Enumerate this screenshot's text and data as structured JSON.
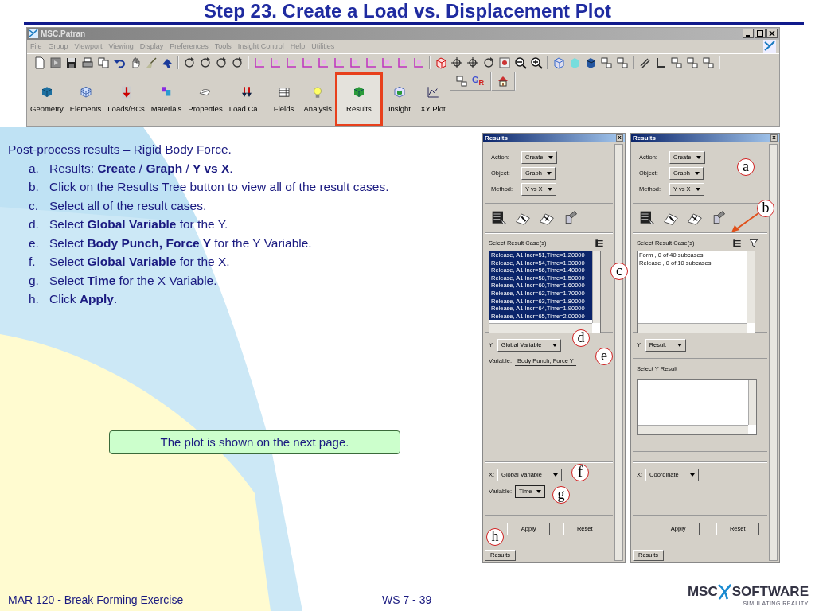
{
  "title": "Step 23. Create a Load vs. Displacement Plot",
  "app_window": {
    "title": "MSC.Patran",
    "menu": [
      "File",
      "Group",
      "Viewport",
      "Viewing",
      "Display",
      "Preferences",
      "Tools",
      "Insight Control",
      "Help",
      "Utilities"
    ],
    "apps": [
      {
        "label": "Geometry",
        "selected": false
      },
      {
        "label": "Elements",
        "selected": false
      },
      {
        "label": "Loads/BCs",
        "selected": false
      },
      {
        "label": "Materials",
        "selected": false
      },
      {
        "label": "Properties",
        "selected": false
      },
      {
        "label": "Load Ca...",
        "selected": false
      },
      {
        "label": "Fields",
        "selected": false
      },
      {
        "label": "Analysis",
        "selected": false
      },
      {
        "label": "Results",
        "selected": true
      },
      {
        "label": "Insight",
        "selected": false
      },
      {
        "label": "XY Plot",
        "selected": false
      }
    ],
    "gr_button": "G$_{R}$"
  },
  "instructions": {
    "intro": "Post-process results – Rigid Body Force.",
    "steps": [
      {
        "marker": "a.",
        "text": "Results: **Create** / **Graph** /   **Y vs X**."
      },
      {
        "marker": "b.",
        "text": "Click on the Results Tree button to view all of the result cases."
      },
      {
        "marker": "c.",
        "text": "Select all of the result cases."
      },
      {
        "marker": "d.",
        "text": "Select **Global Variable** for the Y."
      },
      {
        "marker": "e.",
        "text": "Select **Body Punch, Force Y** for the Y Variable."
      },
      {
        "marker": "f.",
        "text": "Select **Global Variable** for the X."
      },
      {
        "marker": "g.",
        "text": "Select **Time** for the X Variable."
      },
      {
        "marker": "h.",
        "text": "Click **Apply**."
      }
    ]
  },
  "note": "The plot is shown on the next page.",
  "panels": [
    {
      "title": "Results",
      "close": "x",
      "action": {
        "label": "Action:",
        "value": "Create"
      },
      "object": {
        "label": "Object:",
        "value": "Graph"
      },
      "method": {
        "label": "Method:",
        "value": "Y vs X"
      },
      "cases_label": "Select Result Case(s)",
      "filter_button": false,
      "cases": [
        {
          "text": "Release, A1:Incr=51,Time=1.20000",
          "selected": true
        },
        {
          "text": "Release, A1:Incr=54,Time=1.30000",
          "selected": true
        },
        {
          "text": "Release, A1:Incr=56,Time=1.40000",
          "selected": true
        },
        {
          "text": "Release, A1:Incr=58,Time=1.50000",
          "selected": true
        },
        {
          "text": "Release, A1:Incr=60,Time=1.60000",
          "selected": true
        },
        {
          "text": "Release, A1:Incr=62,Time=1.70000",
          "selected": true
        },
        {
          "text": "Release, A1:Incr=63,Time=1.80000",
          "selected": true
        },
        {
          "text": "Release, A1:Incr=64,Time=1.90000",
          "selected": true
        },
        {
          "text": "Release, A1:Incr=65,Time=2.00000",
          "selected": true
        }
      ],
      "y": {
        "label": "Y:",
        "value": "Global Variable"
      },
      "y_variable": {
        "label": "Variable:",
        "value": "Body Punch, Force Y"
      },
      "x": {
        "label": "X:",
        "value": "Global Variable"
      },
      "x_variable": {
        "label": "Variable:",
        "value": "Time"
      },
      "buttons": [
        "Apply",
        "Reset"
      ],
      "tab": "Results"
    },
    {
      "title": "Results",
      "close": "x",
      "action": {
        "label": "Action:",
        "value": "Create"
      },
      "object": {
        "label": "Object:",
        "value": "Graph"
      },
      "method": {
        "label": "Method:",
        "value": "Y vs X"
      },
      "cases_label": "Select Result Case(s)",
      "filter_button": true,
      "cases": [
        {
          "text": "Form , 0 of 40 subcases",
          "selected": false
        },
        {
          "text": "Release , 0 of 10 subcases",
          "selected": false
        }
      ],
      "y": {
        "label": "Y:",
        "value": "Result"
      },
      "y_result_label": "Select Y Result",
      "x": {
        "label": "X:",
        "value": "Coordinate"
      },
      "buttons": [
        "Apply",
        "Reset"
      ],
      "tab": "Results"
    }
  ],
  "callouts": [
    {
      "letter": "a"
    },
    {
      "letter": "b"
    },
    {
      "letter": "c"
    },
    {
      "letter": "d"
    },
    {
      "letter": "e"
    },
    {
      "letter": "f"
    },
    {
      "letter": "g"
    },
    {
      "letter": "h"
    }
  ],
  "footer": {
    "course": "MAR 120 - Break Forming Exercise",
    "page": "WS 7 - 39"
  },
  "logo": {
    "name": "MSC",
    "product": "SOFTWARE",
    "tagline": "SIMULATING REALITY"
  }
}
